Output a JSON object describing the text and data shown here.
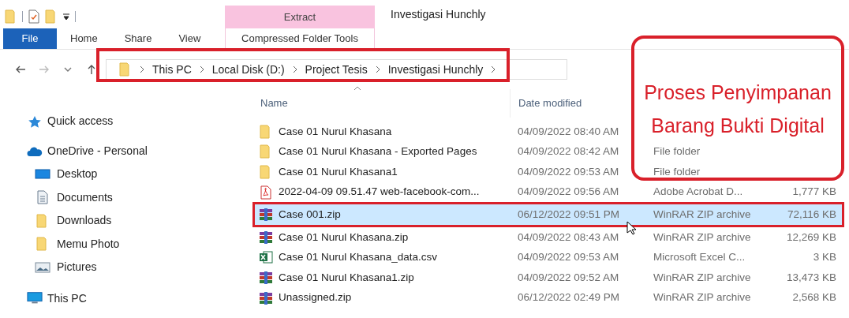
{
  "window": {
    "title": "Investigasi Hunchly"
  },
  "ribbon": {
    "tabs": [
      {
        "label": "File",
        "kind": "file",
        "selected": false
      },
      {
        "label": "Home",
        "kind": "tab",
        "selected": false
      },
      {
        "label": "Share",
        "kind": "tab",
        "selected": false
      },
      {
        "label": "View",
        "kind": "tab",
        "selected": false
      }
    ],
    "context_group": {
      "label": "Extract",
      "tab": "Compressed Folder Tools"
    }
  },
  "address_bar": {
    "path": [
      "This PC",
      "Local Disk (D:)",
      "Project Tesis",
      "Investigasi Hunchly"
    ]
  },
  "sidebar": {
    "items": [
      {
        "label": "Quick access",
        "kind": "star"
      },
      {
        "label": "OneDrive - Personal",
        "kind": "cloud",
        "children": [
          {
            "label": "Desktop",
            "kind": "desktop"
          },
          {
            "label": "Documents",
            "kind": "documents"
          },
          {
            "label": "Downloads",
            "kind": "folder"
          },
          {
            "label": "Memu Photo",
            "kind": "folder"
          },
          {
            "label": "Pictures",
            "kind": "pictures"
          }
        ]
      },
      {
        "label": "This PC",
        "kind": "pc"
      }
    ]
  },
  "file_list": {
    "columns": [
      "Name",
      "Date modified"
    ],
    "rows": [
      {
        "kind": "folder",
        "name": "Case 01 Nurul Khasana",
        "date": "04/09/2022 08:40 AM",
        "selected": false
      },
      {
        "kind": "folder",
        "name": "Case 01 Nurul Khasana - Exported Pages",
        "date": "04/09/2022 08:42 AM",
        "type": "File folder",
        "selected": false
      },
      {
        "kind": "folder",
        "name": "Case 01 Nurul Khasana1",
        "date": "04/09/2022 09:53 AM",
        "type": "File folder",
        "selected": false
      },
      {
        "kind": "pdf",
        "name": "2022-04-09 09.51.47 web-facebook-com...",
        "date": "04/09/2022 09:56 AM",
        "type": "Adobe Acrobat D...",
        "size": "1,777 KB",
        "selected": false
      },
      {
        "kind": "zip",
        "name": "Case 001.zip",
        "date": "06/12/2022 09:51 PM",
        "type": "WinRAR ZIP archive",
        "size": "72,116 KB",
        "selected": true
      },
      {
        "kind": "zip",
        "name": "Case 01 Nurul Khasana.zip",
        "date": "04/09/2022 08:43 AM",
        "type": "WinRAR ZIP archive",
        "size": "12,269 KB",
        "selected": false
      },
      {
        "kind": "csv",
        "name": "Case 01 Nurul Khasana_data.csv",
        "date": "04/09/2022 09:53 AM",
        "type": "Microsoft Excel C...",
        "size": "3 KB",
        "selected": false
      },
      {
        "kind": "zip",
        "name": "Case 01 Nurul Khasana1.zip",
        "date": "04/09/2022 09:52 AM",
        "type": "WinRAR ZIP archive",
        "size": "13,473 KB",
        "selected": false
      },
      {
        "kind": "zip",
        "name": "Unassigned.zip",
        "date": "06/12/2022 02:49 PM",
        "type": "WinRAR ZIP archive",
        "size": "2,568 KB",
        "selected": false
      }
    ]
  },
  "annotation": {
    "lines": [
      "Proses Penyimpanan",
      "Barang Bukti Digital"
    ]
  }
}
